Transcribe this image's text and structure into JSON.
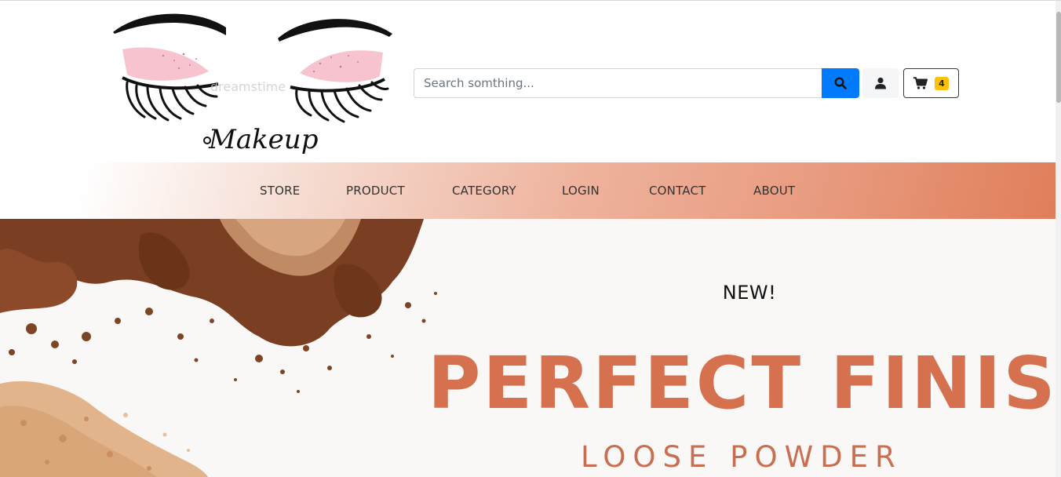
{
  "brand": {
    "logo_text": "Makeup",
    "watermark": "dreamstime"
  },
  "search": {
    "placeholder": "Search somthing...",
    "icon": "search-icon"
  },
  "header_actions": {
    "user_icon": "user-icon",
    "cart_icon": "cart-icon",
    "cart_count": "4"
  },
  "nav": {
    "items": [
      "STORE",
      "PRODUCT",
      "CATEGORY",
      "LOGIN",
      "CONTACT",
      "ABOUT"
    ]
  },
  "hero": {
    "badge": "NEW!",
    "title": "PERFECT FINISH",
    "subtitle": "LOOSE POWDER"
  },
  "colors": {
    "accent": "#007bff",
    "nav_gradient_end": "#e07e5a",
    "hero_title": "#d5714f",
    "badge": "#ffc107"
  }
}
